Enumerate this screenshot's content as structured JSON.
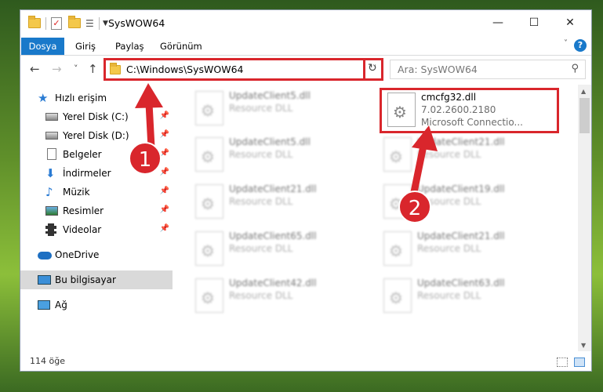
{
  "window": {
    "title": "SysWOW64",
    "minimize": "—",
    "maximize": "☐",
    "close": "✕"
  },
  "ribbon": {
    "tabs": [
      "Dosya",
      "Giriş",
      "Paylaş",
      "Görünüm"
    ],
    "help": "?"
  },
  "nav": {
    "back": "←",
    "forward": "→",
    "recent": "˅",
    "up": "↑",
    "address": "C:\\Windows\\SysWOW64",
    "refresh": "↻",
    "search_placeholder": "Ara: SysWOW64"
  },
  "sidebar": {
    "items": [
      {
        "label": "Hızlı erişim",
        "icon": "star-icon"
      },
      {
        "label": "Yerel Disk (C:)",
        "icon": "disk-icon",
        "pinned": true
      },
      {
        "label": "Yerel Disk (D:)",
        "icon": "disk-icon",
        "pinned": true
      },
      {
        "label": "Belgeler",
        "icon": "document-icon",
        "pinned": true
      },
      {
        "label": "İndirmeler",
        "icon": "download-icon",
        "pinned": true
      },
      {
        "label": "Müzik",
        "icon": "music-icon",
        "pinned": true
      },
      {
        "label": "Resimler",
        "icon": "pictures-icon",
        "pinned": true
      },
      {
        "label": "Videolar",
        "icon": "video-icon",
        "pinned": true
      },
      {
        "label": "OneDrive",
        "icon": "cloud-icon"
      },
      {
        "label": "Bu bilgisayar",
        "icon": "computer-icon",
        "selected": true
      },
      {
        "label": "Ağ",
        "icon": "network-icon"
      }
    ]
  },
  "files": {
    "highlighted": {
      "name": "cmcfg32.dll",
      "version": "7.02.2600.2180",
      "description": "Microsoft Connectio..."
    },
    "blurred": [
      {
        "name": "UpdateClient5.dll",
        "type": "Resource DLL"
      },
      {
        "name": "UpdateClient5.dll",
        "type": "Resource DLL"
      },
      {
        "name": "UpdateClient21.dll",
        "type": "Resource DLL"
      },
      {
        "name": "UpdateClient21.dll",
        "type": "Resource DLL"
      },
      {
        "name": "UpdateClient19.dll",
        "type": "Resource DLL"
      },
      {
        "name": "UpdateClient65.dll",
        "type": "Resource DLL"
      },
      {
        "name": "UpdateClient21.dll",
        "type": "Resource DLL"
      },
      {
        "name": "UpdateClient42.dll",
        "type": "Resource DLL"
      },
      {
        "name": "UpdateClient63.dll",
        "type": "Resource DLL"
      }
    ]
  },
  "status": {
    "count": "114 öğe"
  },
  "annotations": {
    "step1": "1",
    "step2": "2",
    "accent": "#d9262c"
  }
}
